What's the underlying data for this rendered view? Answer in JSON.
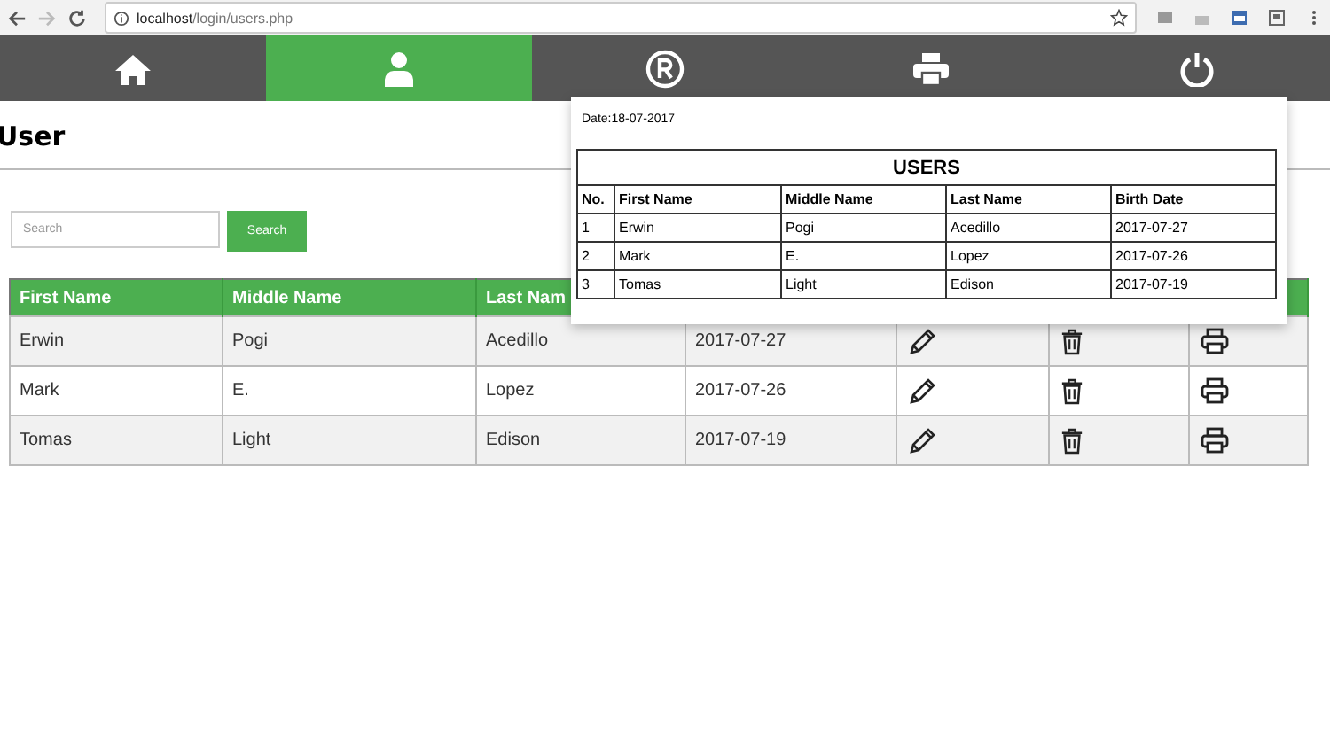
{
  "browser": {
    "url_host": "localhost",
    "url_path": "/login/users.php"
  },
  "nav": [
    {
      "kind": "home",
      "selected": false
    },
    {
      "kind": "user",
      "selected": true
    },
    {
      "kind": "registered",
      "selected": false
    },
    {
      "kind": "print",
      "selected": false
    },
    {
      "kind": "power",
      "selected": false
    }
  ],
  "page_title": "User",
  "search": {
    "placeholder": "Search",
    "button": "Search"
  },
  "table": {
    "columns": [
      "First Name",
      "Middle Name",
      "Last Nam"
    ],
    "rows": [
      {
        "first": "Erwin",
        "middle": "Pogi",
        "last": "Acedillo",
        "birth": "2017-07-27"
      },
      {
        "first": "Mark",
        "middle": "E.",
        "last": "Lopez",
        "birth": "2017-07-26"
      },
      {
        "first": "Tomas",
        "middle": "Light",
        "last": "Edison",
        "birth": "2017-07-19"
      }
    ]
  },
  "print_preview": {
    "date": "Date:18-07-2017",
    "title": "USERS",
    "columns": [
      "No.",
      "First Name",
      "Middle Name",
      "Last Name",
      "Birth Date"
    ],
    "rows": [
      [
        "1",
        "Erwin",
        "Pogi",
        "Acedillo",
        "2017-07-27"
      ],
      [
        "2",
        "Mark",
        "E.",
        "Lopez",
        "2017-07-26"
      ],
      [
        "3",
        "Tomas",
        "Light",
        "Edison",
        "2017-07-19"
      ]
    ]
  }
}
